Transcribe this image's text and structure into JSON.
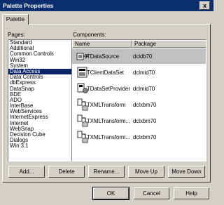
{
  "window": {
    "title": "Palette Properties",
    "close_glyph": "x"
  },
  "tabs": [
    {
      "label": "Palette"
    }
  ],
  "pages": {
    "label": "Pages:",
    "items": [
      "Standard",
      "Additional",
      "Common Controls",
      "Win32",
      "System",
      "Data Access",
      "Data Controls",
      "dbExpress",
      "DataSnap",
      "BDE",
      "ADO",
      "InterBase",
      "WebServices",
      "InternetExpress",
      "Internet",
      "WebSnap",
      "Decision Cube",
      "Dialogs",
      "Win 3.1"
    ],
    "selected": "Data Access"
  },
  "components": {
    "label": "Components:",
    "columns": [
      "Name",
      "Package"
    ],
    "rows": [
      {
        "name": "TDataSource",
        "package": "dcldb70",
        "icon": "datasource-icon",
        "selected": true
      },
      {
        "name": "TClientDataSet",
        "package": "dclmid70",
        "icon": "clientdataset-icon",
        "selected": false
      },
      {
        "name": "TDataSetProvider",
        "package": "dclmid70",
        "icon": "datasetprovider-icon",
        "selected": false
      },
      {
        "name": "TXMLTransform",
        "package": "dclxbm70",
        "icon": "xmltransform-icon",
        "selected": false
      },
      {
        "name": "TXMLTransform...",
        "package": "dclxbm70",
        "icon": "xmltransform-icon",
        "selected": false
      },
      {
        "name": "TXMLTransform...",
        "package": "dclxbm70",
        "icon": "xmltransform-icon",
        "selected": false
      }
    ]
  },
  "actions": {
    "add": "Add...",
    "delete": "Delete",
    "rename": "Rename...",
    "move_up": "Move Up",
    "move_down": "Move Down"
  },
  "footer": {
    "ok": "OK",
    "cancel": "Cancel",
    "help": "Help"
  },
  "colors": {
    "titlebar": "#0a2e6e",
    "face": "#d4d0c8",
    "selection": "#0a246a"
  }
}
